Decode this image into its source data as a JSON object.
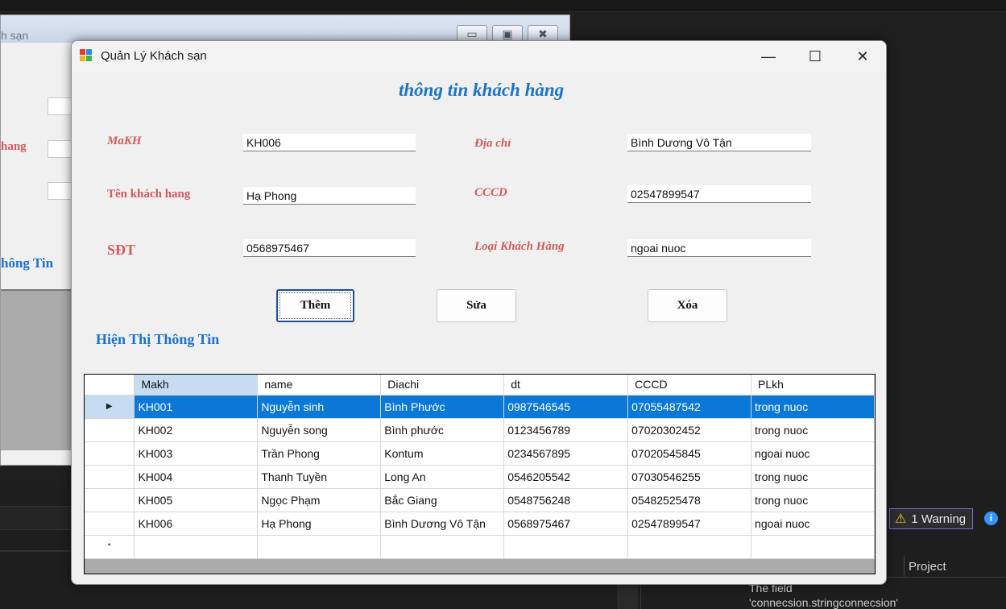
{
  "ide": {
    "warning_label": "1 Warning",
    "project_header": "Project",
    "message_line1": "The field",
    "message_line2": "'connecsion.stringconnecsion'"
  },
  "behind_window": {
    "title": "h sạn",
    "label_1": "hang",
    "label_2": "hông Tin"
  },
  "window": {
    "title": "Quản Lý Khách sạn",
    "minimize": "—",
    "maximize": "☐",
    "close": "✕"
  },
  "form": {
    "heading": "thông tin khách hàng",
    "makh_label": "MaKH",
    "makh_value": "KH006",
    "ten_label": "Tên khách hang",
    "ten_value": "Hạ Phong",
    "sdt_label": "SĐT",
    "sdt_value": "0568975467",
    "diachi_label": "Địa chỉ",
    "diachi_value": "Bình Dương Vô Tận",
    "cccd_label": "CCCD",
    "cccd_value": "02547899547",
    "loai_label": "Loại Khách Hàng",
    "loai_value": "ngoai nuoc",
    "btn_them": "Thêm",
    "btn_sua": "Sửa",
    "btn_xoa": "Xóa",
    "section_title": "Hiện Thị Thông Tin"
  },
  "grid": {
    "columns": [
      "Makh",
      "name",
      "Diachi",
      "dt",
      "CCCD",
      "PLkh"
    ],
    "rows": [
      [
        "KH001",
        "Nguyễn sinh",
        "Bình Phước",
        "0987546545",
        "07055487542",
        "trong nuoc"
      ],
      [
        "KH002",
        "Nguyễn song",
        "Bình phước",
        "0123456789",
        "07020302452",
        "trong nuoc"
      ],
      [
        "KH003",
        "Trần Phong",
        "Kontum",
        "0234567895",
        "07020545845",
        "ngoai nuoc"
      ],
      [
        "KH004",
        "Thanh Tuyền",
        "Long An",
        "0546205542",
        "07030546255",
        "trong nuoc"
      ],
      [
        "KH005",
        "Ngọc Phạm",
        "Bắc Giang",
        "0548756248",
        "05482525478",
        "trong nuoc"
      ],
      [
        "KH006",
        "Hạ Phong",
        "Bình Dương Vô Tận",
        "0568975467",
        "02547899547",
        "ngoai nuoc"
      ]
    ],
    "selected_row_marker": "▶",
    "new_row_marker": "*"
  },
  "colors": {
    "heading_blue": "#1a73c9",
    "label_red": "#d15a5a",
    "selection_blue": "#0a78d7"
  }
}
